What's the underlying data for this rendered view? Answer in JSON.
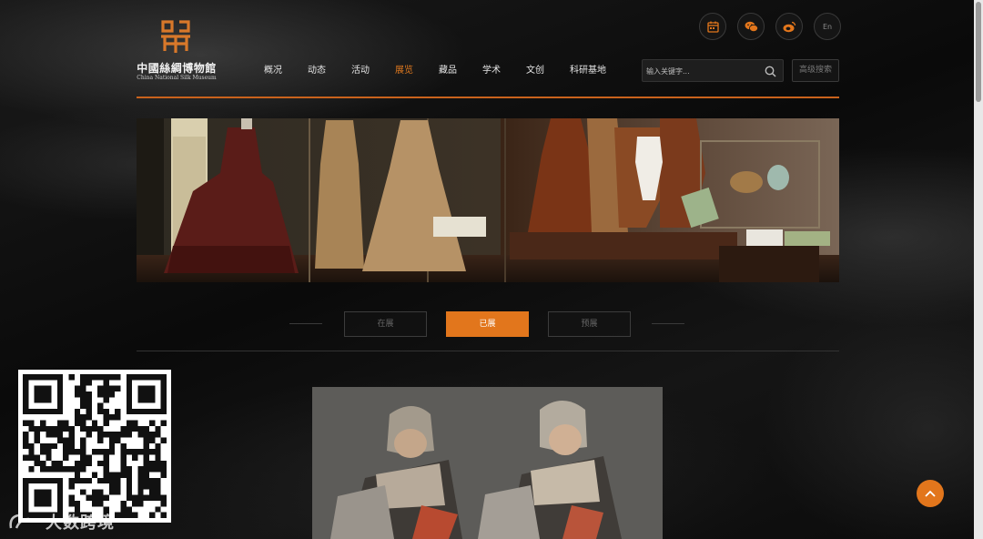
{
  "header": {
    "logo_cn": "中國絲綢博物館",
    "logo_en": "China National Silk Museum",
    "icons": [
      "calendar-icon",
      "wechat-icon",
      "weibo-icon"
    ],
    "lang_label": "En"
  },
  "nav": {
    "items": [
      {
        "label": "概况",
        "active": false
      },
      {
        "label": "动态",
        "active": false
      },
      {
        "label": "活动",
        "active": false
      },
      {
        "label": "展览",
        "active": true
      },
      {
        "label": "藏品",
        "active": false
      },
      {
        "label": "学术",
        "active": false
      },
      {
        "label": "文创",
        "active": false
      },
      {
        "label": "科研基地",
        "active": false
      }
    ]
  },
  "search": {
    "placeholder": "输入关键字...",
    "advanced_label": "高级搜索"
  },
  "tabs": {
    "current": "在展",
    "past": "已展",
    "upcoming": "预展",
    "active": "past"
  },
  "watermark": {
    "text": "大数跨境"
  },
  "colors": {
    "accent": "#e2761c",
    "background": "#0d0d0d"
  }
}
